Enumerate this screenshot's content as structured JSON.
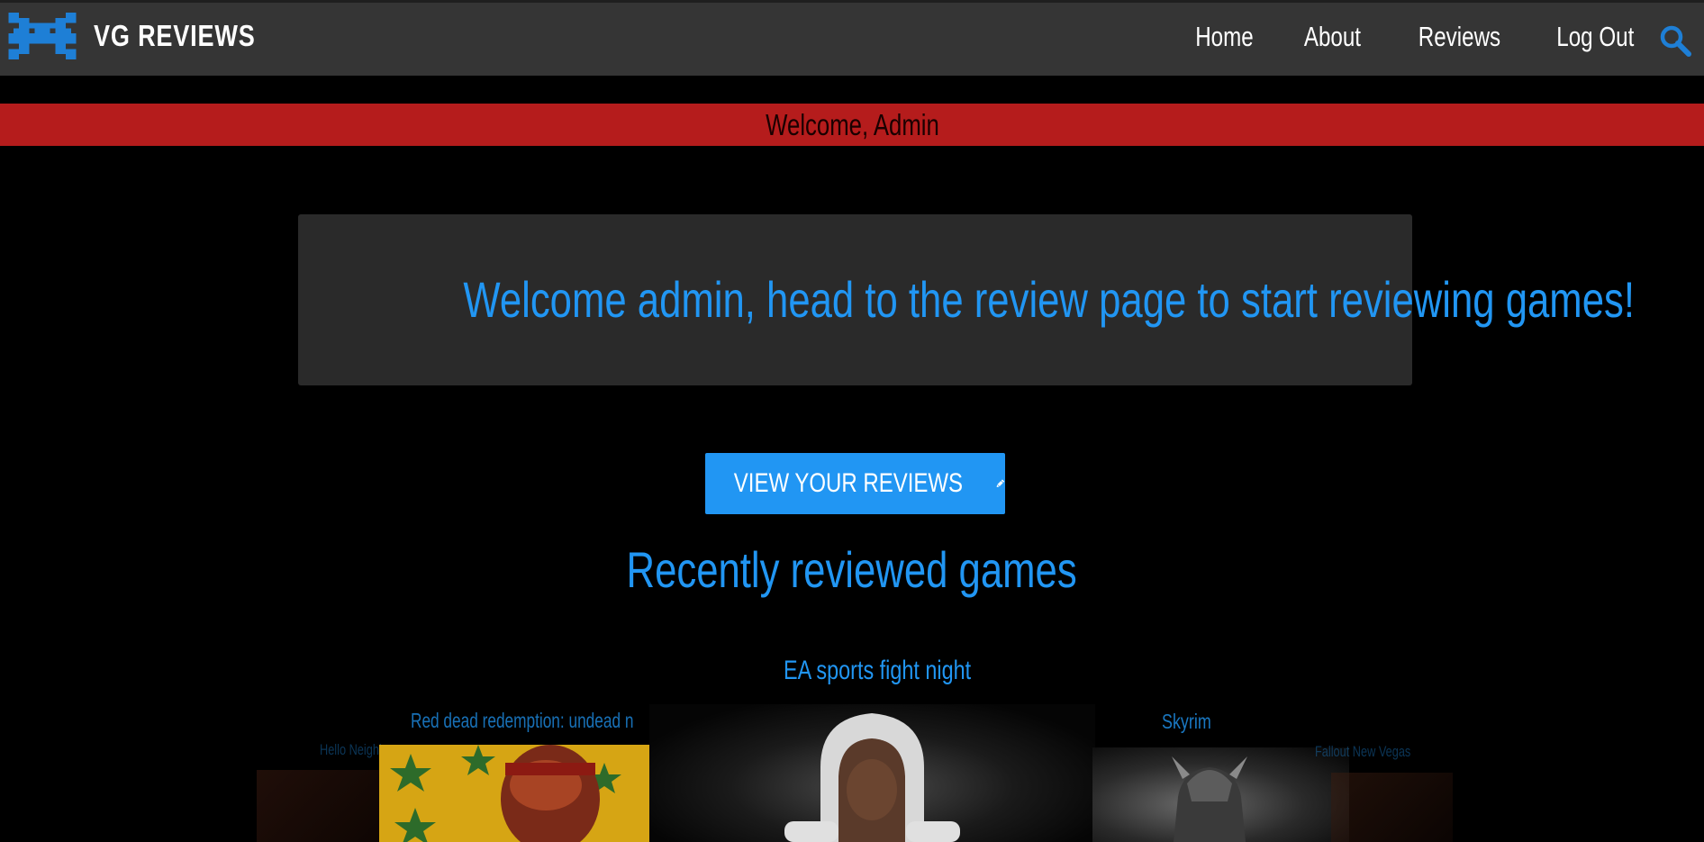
{
  "navbar": {
    "brand": "VG REVIEWS",
    "links": [
      "Home",
      "About",
      "Reviews",
      "Log Out"
    ],
    "icons": {
      "logo": "space-invader-icon",
      "search": "search-icon"
    }
  },
  "welcome_bar": {
    "text": "Welcome, Admin"
  },
  "hero": {
    "message": "Welcome admin, head to the review page to start reviewing games!"
  },
  "cta": {
    "label": "VIEW YOUR REVIEWS",
    "icon": "pencil-icon"
  },
  "recent": {
    "title": "Recently reviewed games",
    "games": [
      {
        "title": "Hello Neighbor"
      },
      {
        "title": "Red dead redemption: undead nightmare"
      },
      {
        "title": "EA sports fight night"
      },
      {
        "title": "Skyrim"
      },
      {
        "title": "Fallout New Vegas"
      }
    ]
  },
  "colors": {
    "accent": "#2196f3",
    "navbar": "#353535",
    "welcome_bar": "#b51c1c",
    "hero_bg": "#2a2a2a",
    "page_bg": "#000000"
  }
}
